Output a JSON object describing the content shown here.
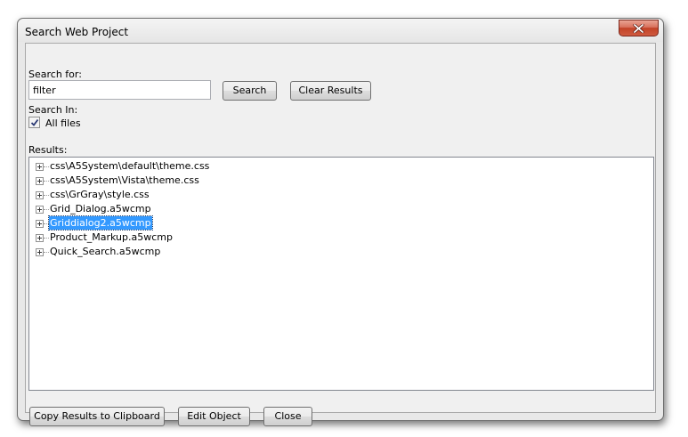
{
  "window": {
    "title": "Search Web Project"
  },
  "search": {
    "label": "Search for:",
    "value": "filter",
    "search_button": "Search",
    "clear_button": "Clear Results"
  },
  "search_in": {
    "label": "Search In:",
    "all_files_label": "All files",
    "all_files_checked": true
  },
  "results": {
    "label": "Results:",
    "items": [
      {
        "label": "css\\A5System\\default\\theme.css",
        "selected": false
      },
      {
        "label": "css\\A5System\\Vista\\theme.css",
        "selected": false
      },
      {
        "label": "css\\GrGray\\style.css",
        "selected": false
      },
      {
        "label": "Grid_Dialog.a5wcmp",
        "selected": false
      },
      {
        "label": "Griddialog2.a5wcmp",
        "selected": true
      },
      {
        "label": "Product_Markup.a5wcmp",
        "selected": false
      },
      {
        "label": "Quick_Search.a5wcmp",
        "selected": false
      }
    ]
  },
  "footer": {
    "copy_button": "Copy Results to Clipboard",
    "edit_button": "Edit Object",
    "close_button": "Close"
  },
  "icons": {
    "close": "close-icon",
    "expand": "plus-expander-icon",
    "check": "checkmark-icon"
  }
}
